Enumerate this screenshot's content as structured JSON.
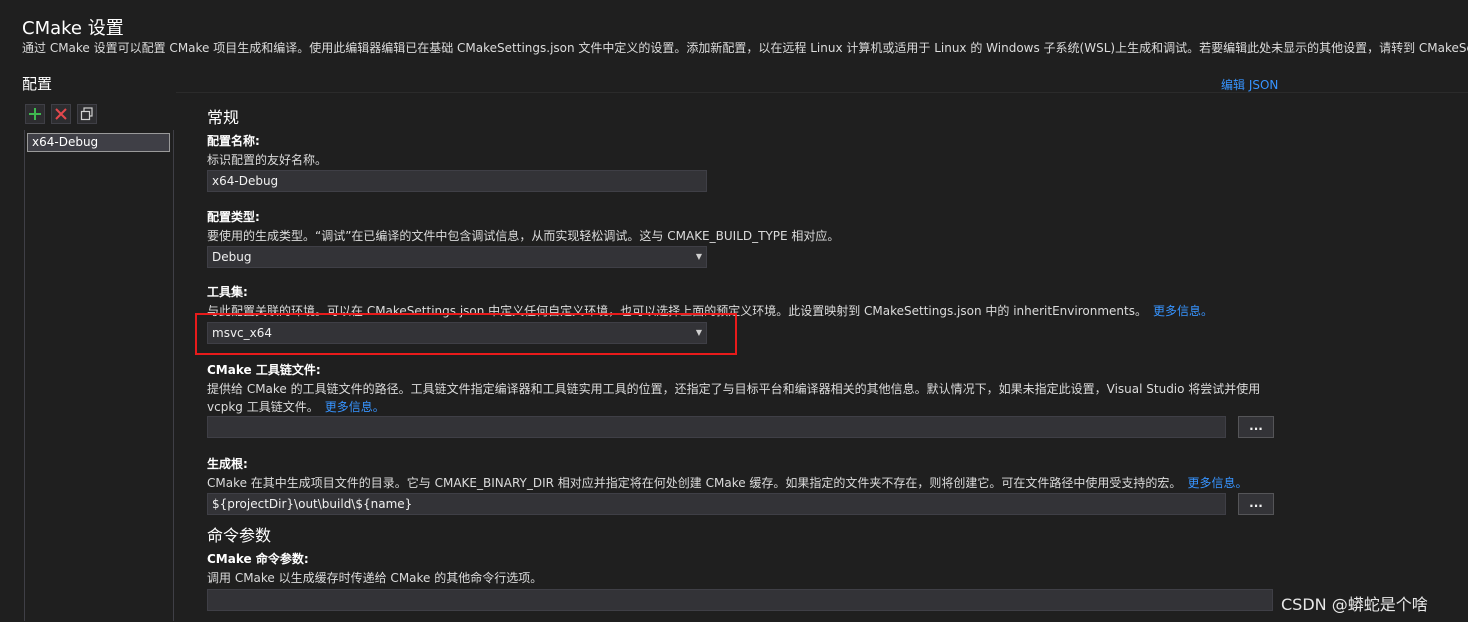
{
  "window": {
    "title": "CMake 设置",
    "description": "通过 CMake 设置可以配置 CMake 项目生成和编译。使用此编辑器编辑已在基础 CMakeSettings.json 文件中定义的设置。添加新配置，以在远程 Linux 计算机或适用于 Linux 的 Windows 子系统(WSL)上生成和调试。若要编辑此处未显示的其他设置，请转到 CMakeSettings.json"
  },
  "sidebar": {
    "heading": "配置",
    "toolbar": {
      "add": "add-icon",
      "remove": "remove-icon",
      "copy": "copy-icon"
    },
    "items": [
      {
        "label": "x64-Debug",
        "selected": true
      }
    ]
  },
  "header": {
    "edit_json": "编辑 JSON"
  },
  "general": {
    "section_title": "常规",
    "config_name": {
      "label": "配置名称:",
      "help": "标识配置的友好名称。",
      "value": "x64-Debug"
    },
    "config_type": {
      "label": "配置类型:",
      "help": "要使用的生成类型。“调试”在已编译的文件中包含调试信息，从而实现轻松调试。这与 CMAKE_BUILD_TYPE 相对应。",
      "value": "Debug"
    },
    "toolset": {
      "label": "工具集:",
      "help": "与此配置关联的环境。可以在 CMakeSettings.json 中定义任何自定义环境，也可以选择上面的预定义环境。此设置映射到 CMakeSettings.json 中的 inheritEnvironments。",
      "link": "更多信息。",
      "value": "msvc_x64"
    },
    "toolchain": {
      "label": "CMake 工具链文件:",
      "help_line1": "提供给 CMake 的工具链文件的路径。工具链文件指定编译器和工具链实用工具的位置，还指定了与目标平台和编译器相关的其他信息。默认情况下，如果未指定此设置，Visual Studio 将尝试并使用",
      "help_line2": "vcpkg 工具链文件。",
      "link": "更多信息。",
      "value": "",
      "browse": "..."
    },
    "build_root": {
      "label": "生成根:",
      "help": "CMake 在其中生成项目文件的目录。它与 CMAKE_BINARY_DIR 相对应并指定将在何处创建 CMake 缓存。如果指定的文件夹不存在，则将创建它。可在文件路径中使用受支持的宏。",
      "link": "更多信息。",
      "value": "${projectDir}\\out\\build\\${name}",
      "browse": "..."
    }
  },
  "command_args": {
    "section_title": "命令参数",
    "cmake_args": {
      "label": "CMake 命令参数:",
      "help": "调用 CMake 以生成缓存时传递给 CMake 的其他命令行选项。",
      "value": ""
    }
  },
  "watermark": "CSDN @蟒蛇是个啥",
  "colors": {
    "accent_link": "#3794ff",
    "highlight": "#e81b1b",
    "background": "#1f1f1f"
  }
}
